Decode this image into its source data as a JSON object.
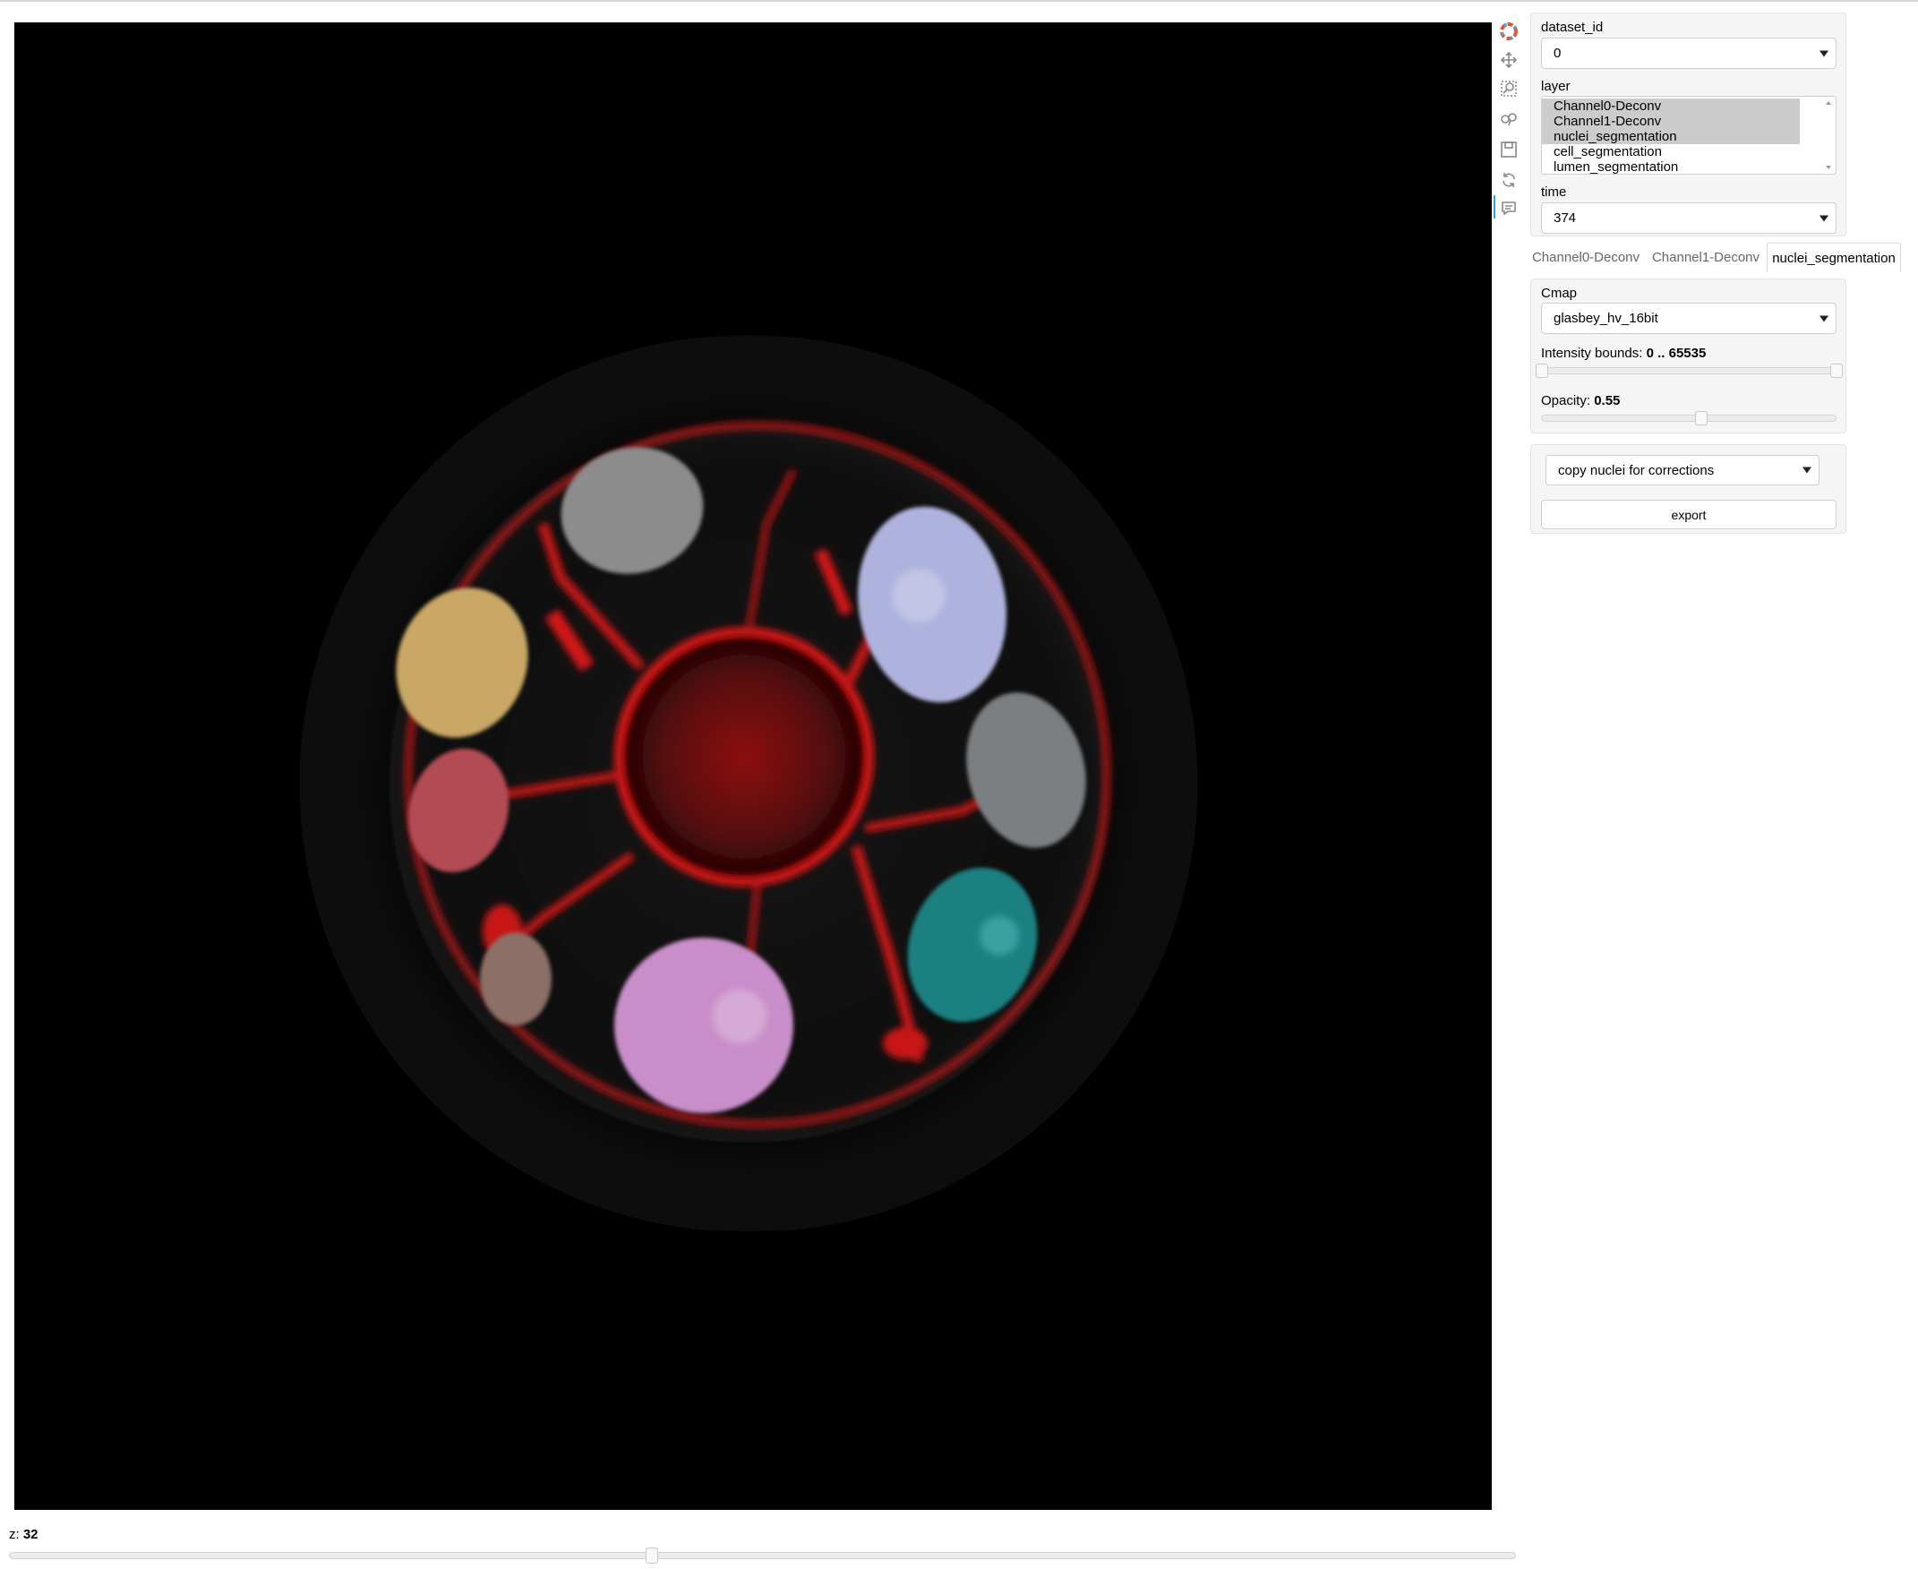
{
  "controls": {
    "dataset": {
      "label": "dataset_id",
      "value": "0"
    },
    "layer": {
      "label": "layer",
      "options": [
        {
          "label": "Channel0-Deconv",
          "selected": true
        },
        {
          "label": "Channel1-Deconv",
          "selected": true
        },
        {
          "label": "nuclei_segmentation",
          "selected": true
        },
        {
          "label": "cell_segmentation",
          "selected": false
        },
        {
          "label": "lumen_segmentation",
          "selected": false
        }
      ]
    },
    "time": {
      "label": "time",
      "value": "374"
    }
  },
  "tabs": [
    {
      "label": "Channel0-Deconv",
      "active": false
    },
    {
      "label": "Channel1-Deconv",
      "active": false
    },
    {
      "label": "nuclei_segmentation",
      "active": true
    }
  ],
  "layer_settings": {
    "cmap_label": "Cmap",
    "cmap_value": "glasbey_hv_16bit",
    "intensity_label": "Intensity bounds:",
    "intensity_value": "0 .. 65535",
    "intensity_bounds": [
      0,
      65535
    ],
    "opacity_label": "Opacity:",
    "opacity_value": "0.55",
    "opacity": 0.55
  },
  "actions": {
    "copy_select_value": "copy nuclei for corrections",
    "export_label": "export"
  },
  "z_slider": {
    "label": "z:",
    "value": "32"
  },
  "toolbar": {
    "tools": [
      "bokeh-logo-icon",
      "pan-icon",
      "box-zoom-icon",
      "wheel-zoom-icon",
      "save-icon",
      "reset-icon",
      "hover-icon"
    ]
  },
  "colors": {
    "nucleus_colors": [
      "#8c8c8c",
      "#c9a865",
      "#b34c55",
      "#8c7068",
      "#c98ec9",
      "#aeb2dd",
      "#7b7f82",
      "#1f8080"
    ]
  }
}
